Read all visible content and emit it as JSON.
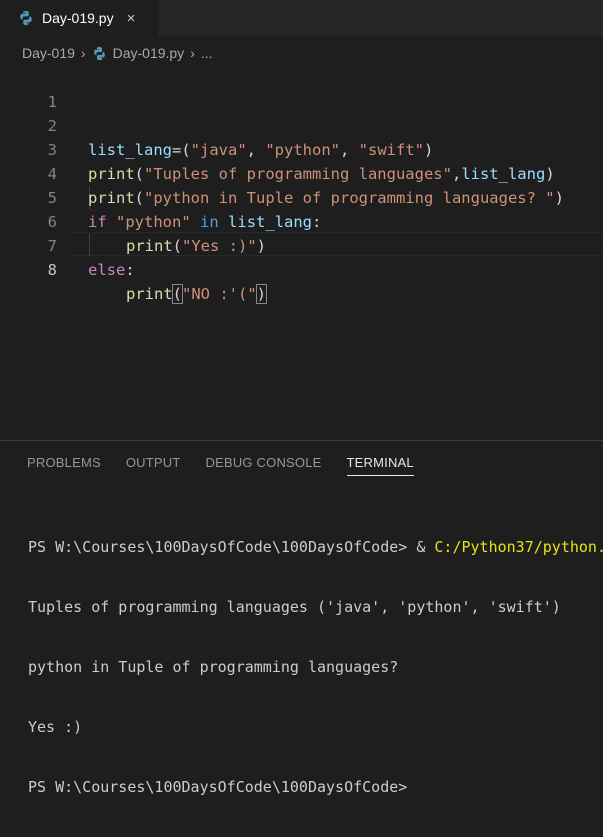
{
  "tab": {
    "label": "Day-019.py",
    "close": "×"
  },
  "breadcrumb": {
    "folder": "Day-019",
    "file": "Day-019.py",
    "more": "..."
  },
  "lines": [
    "1",
    "2",
    "3",
    "4",
    "5",
    "6",
    "7",
    "8"
  ],
  "code": {
    "l2": {
      "a": "list_lang",
      "b": "=(",
      "c": "\"java\"",
      "d": ", ",
      "e": "\"python\"",
      "f": ", ",
      "g": "\"swift\"",
      "h": ")"
    },
    "l3": {
      "a": "print",
      "b": "(",
      "c": "\"Tuples of programming languages\"",
      "d": ",",
      "e": "list_lang",
      "f": ")"
    },
    "l4": {
      "a": "print",
      "b": "(",
      "c": "\"python in Tuple of programming languages? \"",
      "d": ")"
    },
    "l5": {
      "a": "if",
      "b": " ",
      "c": "\"python\"",
      "d": " ",
      "e": "in",
      "f": " ",
      "g": "list_lang",
      "h": ":"
    },
    "l6": {
      "a": "print",
      "b": "(",
      "c": "\"Yes :)\"",
      "d": ")"
    },
    "l7": {
      "a": "else",
      "b": ":"
    },
    "l8": {
      "a": "print",
      "b": "(",
      "c": "\"NO :'(\"",
      "d": ")"
    }
  },
  "panel": {
    "tabs": [
      "PROBLEMS",
      "OUTPUT",
      "DEBUG CONSOLE",
      "TERMINAL"
    ],
    "active": "TERMINAL"
  },
  "terminal": {
    "prompt1": "PS W:\\Courses\\100DaysOfCode\\100DaysOfCode> & ",
    "cmd_path": "C:/Python37/python.",
    "out1": "Tuples of programming languages ('java', 'python', 'swift')",
    "out2": "python in Tuple of programming languages?",
    "out3": "Yes :)",
    "prompt2": "PS W:\\Courses\\100DaysOfCode\\100DaysOfCode>"
  },
  "colors": {
    "editor_bg": "#1e1e1e",
    "tabbar_bg": "#252526",
    "function": "#dcdcaa",
    "string": "#ce9178",
    "keyword": "#c586c0",
    "keyword_blue": "#569cd6",
    "variable": "#9cdcfe",
    "terminal_path": "#e5e510"
  },
  "icons": [
    "python-file-icon",
    "close-icon",
    "chevron-right-icon"
  ]
}
